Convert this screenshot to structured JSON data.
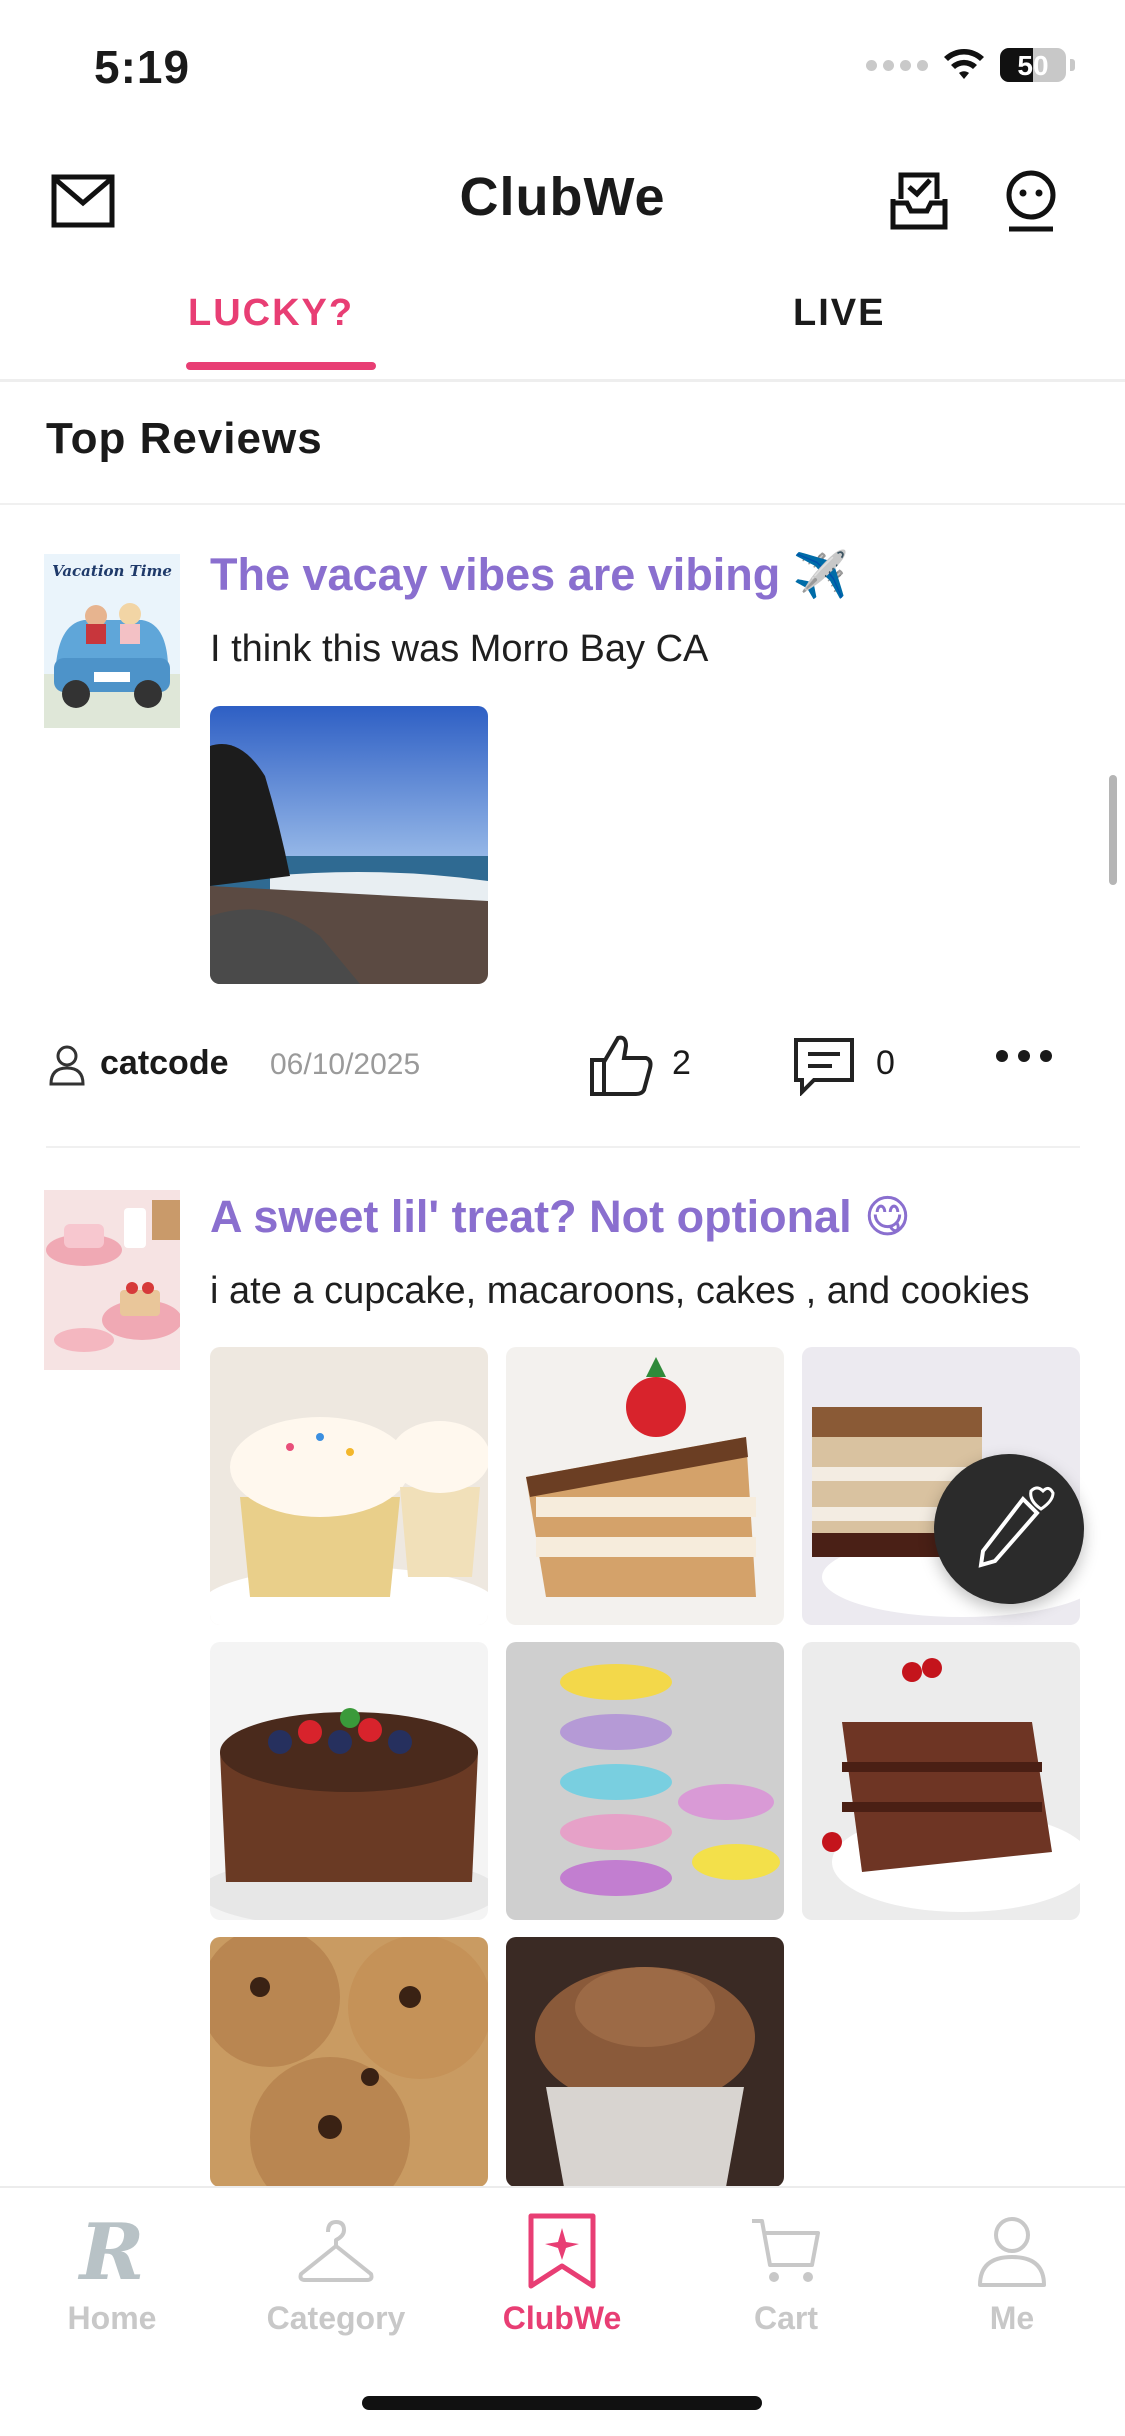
{
  "status_bar": {
    "time": "5:19",
    "battery": "50",
    "battery_level": 0.5
  },
  "header": {
    "title": "ClubWe"
  },
  "tabs": [
    {
      "label": "LUCKY?",
      "active": true
    },
    {
      "label": "LIVE",
      "active": false
    }
  ],
  "section": {
    "title": "Top Reviews"
  },
  "posts": [
    {
      "avatar_caption": "Vacation Time",
      "title": "The vacay vibes are vibing ✈️",
      "body": "I think this was Morro Bay CA",
      "author": "catcode",
      "date": "06/10/2025",
      "likes": "2",
      "comments": "0"
    },
    {
      "title": "A sweet lil' treat? Not optional 😋",
      "body": "i ate a cupcake, macaroons, cakes , and cookies"
    }
  ],
  "bottom_nav": [
    {
      "label": "Home",
      "icon": "home-r-icon",
      "active": false
    },
    {
      "label": "Category",
      "icon": "hanger-icon",
      "active": false
    },
    {
      "label": "ClubWe",
      "icon": "bookmark-star-icon",
      "active": true
    },
    {
      "label": "Cart",
      "icon": "cart-icon",
      "active": false
    },
    {
      "label": "Me",
      "icon": "person-icon",
      "active": false
    }
  ],
  "colors": {
    "accent": "#e83e74",
    "title_purple": "#8a6fcf",
    "inactive": "#c8c8c8"
  }
}
